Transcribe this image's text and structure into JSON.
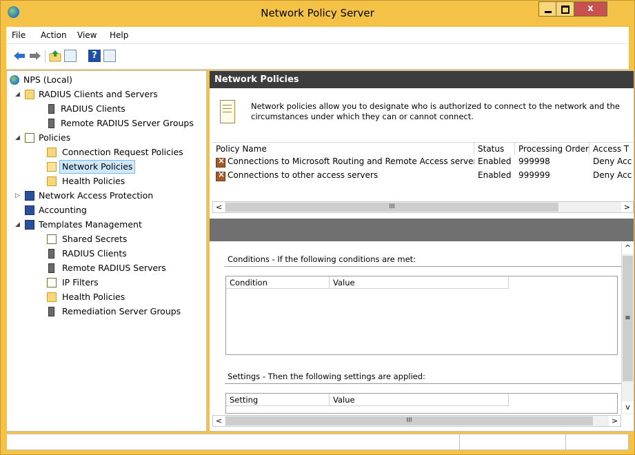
{
  "window": {
    "title": "Network Policy Server",
    "close_glyph": "x"
  },
  "menu": [
    "File",
    "Action",
    "View",
    "Help"
  ],
  "toolbar": [
    "back-arrow-icon",
    "forward-arrow-icon",
    "up-folder-icon",
    "show-hide-console-tree-icon",
    "help-icon",
    "action-pane-icon"
  ],
  "toolbar_help_glyph": "?",
  "tree": {
    "root": "NPS (Local)",
    "radius_clients_servers": "RADIUS Clients and Servers",
    "radius_clients": "RADIUS Clients",
    "remote_radius_server_groups": "Remote RADIUS Server Groups",
    "policies": "Policies",
    "connection_request_policies": "Connection Request Policies",
    "network_policies": "Network Policies",
    "health_policies": "Health Policies",
    "network_access_protection": "Network Access Protection",
    "accounting": "Accounting",
    "templates_management": "Templates Management",
    "shared_secrets": "Shared Secrets",
    "tm_radius_clients": "RADIUS Clients",
    "remote_radius_servers": "Remote RADIUS Servers",
    "ip_filters": "IP Filters",
    "tm_health_policies": "Health Policies",
    "remediation_server_groups": "Remediation Server Groups"
  },
  "main": {
    "header": "Network Policies",
    "description": "Network policies allow you to designate who is authorized to connect to the network and the circumstances under which they can or cannot connect.",
    "columns": [
      "Policy Name",
      "Status",
      "Processing Order",
      "Access T"
    ],
    "rows": [
      {
        "name": "Connections to Microsoft Routing and Remote Access server",
        "status": "Enabled",
        "order": "999998",
        "access": "Deny Acc"
      },
      {
        "name": "Connections to other access servers",
        "status": "Enabled",
        "order": "999999",
        "access": "Deny Acc"
      }
    ],
    "conditions_title": "Conditions - If the following conditions are met:",
    "conditions_columns": [
      "Condition",
      "Value"
    ],
    "settings_title": "Settings - Then the following settings are applied:",
    "settings_columns": [
      "Setting",
      "Value"
    ],
    "scroll_glyphs": {
      "left": "<",
      "right": ">",
      "up": "^",
      "down": "v",
      "thumb_h": "III",
      "thumb_v": "≡"
    }
  },
  "colors": {
    "frame": "#f4c247",
    "header_bg": "#3c3c3c",
    "divider": "#707070",
    "selection": "#cde8ff",
    "close_button": "#c75050"
  }
}
